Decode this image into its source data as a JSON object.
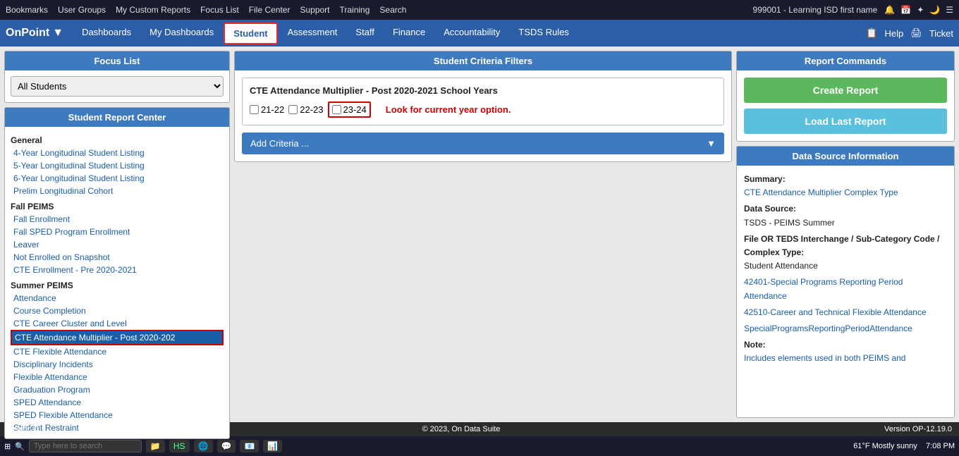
{
  "topbar": {
    "items": [
      "Bookmarks",
      "User Groups",
      "My Custom Reports",
      "Focus List",
      "File Center",
      "Support",
      "Training",
      "Search"
    ],
    "right": "999001 - Learning ISD first name"
  },
  "navbar": {
    "brand": "OnPoint",
    "items": [
      "Dashboards",
      "My Dashboards",
      "Student",
      "Assessment",
      "Staff",
      "Finance",
      "Accountability",
      "TSDS Rules"
    ],
    "active": "Student",
    "help": "Help",
    "ticket": "Ticket"
  },
  "left": {
    "focus_header": "Focus List",
    "focus_options": [
      "All Students"
    ],
    "focus_selected": "All Students",
    "report_center_header": "Student Report Center",
    "sections": [
      {
        "label": "General",
        "items": [
          "4-Year Longitudinal Student Listing",
          "5-Year Longitudinal Student Listing",
          "6-Year Longitudinal Student Listing",
          "Prelim Longitudinal Cohort"
        ]
      },
      {
        "label": "Fall PEIMS",
        "items": [
          "Fall Enrollment",
          "Fall SPED Program Enrollment",
          "Leaver",
          "Not Enrolled on Snapshot",
          "CTE Enrollment - Pre 2020-2021"
        ]
      },
      {
        "label": "Summer PEIMS",
        "items": [
          "Attendance",
          "Course Completion",
          "CTE Career Cluster and Level",
          "CTE Attendance Multiplier - Post 2020-202",
          "CTE Flexible Attendance",
          "Disciplinary Incidents",
          "Flexible Attendance",
          "Graduation Program",
          "SPED Attendance",
          "SPED Flexible Attendance",
          "Student Restraint"
        ]
      }
    ],
    "selected_item": "CTE Attendance Multiplier - Post 2020-202"
  },
  "center": {
    "header": "Student Criteria Filters",
    "filter_title": "CTE Attendance Multiplier - Post 2020-2021 School Years",
    "checkboxes": [
      {
        "label": "21-22",
        "checked": false
      },
      {
        "label": "22-23",
        "checked": false
      },
      {
        "label": "23-24",
        "checked": false,
        "highlighted": true
      }
    ],
    "red_message": "Look for current year option.",
    "add_criteria_label": "Add Criteria ..."
  },
  "right": {
    "commands_header": "Report Commands",
    "create_label": "Create Report",
    "load_label": "Load Last Report",
    "datasource_header": "Data Source Information",
    "summary_label": "Summary:",
    "summary_value": "CTE Attendance Multiplier Complex Type",
    "datasource_label": "Data Source:",
    "datasource_value": "TSDS - PEIMS Summer",
    "file_label": "File OR TEDS Interchange / Sub-Category Code / Complex Type:",
    "file_sub": "Student Attendance",
    "file_items": [
      "42401-Special Programs Reporting Period Attendance",
      "42510-Career and Technical Flexible Attendance",
      "SpecialProgramsReportingPeriodAttendance"
    ],
    "note_label": "Note:",
    "note_value": "Includes elements used in both PEIMS and"
  },
  "statusbar": {
    "left": "Region 0",
    "center": "© 2023, On Data Suite",
    "right": "Version OP-12.19.0"
  },
  "taskbar": {
    "time": "7:08 PM",
    "search_placeholder": "Type here to search",
    "temp": "61°F  Mostly sunny"
  }
}
